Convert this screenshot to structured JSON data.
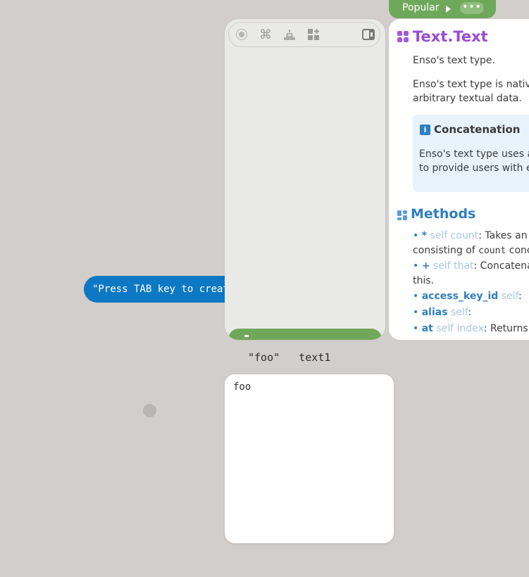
{
  "graph": {
    "node_text": "\"Press TAB key to creat",
    "output_expression": "\"foo\"",
    "output_name": "text1"
  },
  "component_browser": {
    "toolbar_icons": [
      "radio-icon",
      "command-icon",
      "stack-icon",
      "grid-plus-icon",
      "sidebar-toggle-icon"
    ],
    "accent_color": "#6fa85a"
  },
  "docs": {
    "tab_label": "Popular",
    "more_label": "•••",
    "title": "Text.Text",
    "intro": "Enso's text type.",
    "desc_line1": "Enso's text type is native",
    "desc_line2": "arbitrary textual data.",
    "info": {
      "title": "Concatenation",
      "line1": "Enso's text type uses a",
      "line2": "to provide users with ef"
    },
    "methods_title": "Methods",
    "methods": [
      {
        "name": "*",
        "args": "self count",
        "rest1": ": Takes an in",
        "rest2_pre": "consisting of ",
        "rest2_code": "count",
        "rest2_post": " conc"
      },
      {
        "name": "+",
        "args": "self that",
        "rest1": ": Concatenat",
        "rest2": "this."
      },
      {
        "name": "access_key_id",
        "args": "self",
        "rest1": ":"
      },
      {
        "name": "alias",
        "args": "self",
        "rest1": ":"
      },
      {
        "name": "at",
        "args": "self index",
        "rest1": ": Returns a"
      }
    ],
    "title_color": "#9b4ad4",
    "link_color": "#2d7fc1"
  },
  "visualization": {
    "text": "foo"
  }
}
